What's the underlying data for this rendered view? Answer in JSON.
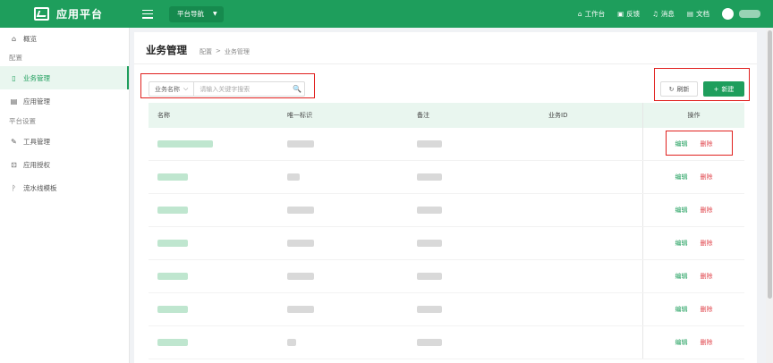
{
  "header": {
    "app_title": "应用平台",
    "nav_select": "平台导航",
    "links": [
      {
        "icon": "home-icon",
        "label": "工作台"
      },
      {
        "icon": "feedback-icon",
        "label": "反馈"
      },
      {
        "icon": "bell-icon",
        "label": "消息"
      },
      {
        "icon": "doc-icon",
        "label": "文档"
      }
    ]
  },
  "sidebar": {
    "overview": "概览",
    "group_config": "配置",
    "business": "业务管理",
    "app_manage": "应用管理",
    "group_platform": "平台设置",
    "tools": "工具管理",
    "app_auth": "应用授权",
    "pipeline": "流水线模板"
  },
  "page": {
    "title": "业务管理",
    "breadcrumb": [
      "配置",
      ">",
      "业务管理"
    ]
  },
  "filter": {
    "field": "业务名称",
    "placeholder": "请输入关键字搜索"
  },
  "toolbar": {
    "refresh": "刷新",
    "create": "新建"
  },
  "table": {
    "columns": [
      "名称",
      "唯一标识",
      "备注",
      "业务ID",
      "操作"
    ],
    "edit": "编辑",
    "delete": "删除",
    "row_count": 7
  },
  "colors": {
    "primary": "#1e9e5c",
    "danger": "#e0444b",
    "annotation": "#e0201e"
  }
}
